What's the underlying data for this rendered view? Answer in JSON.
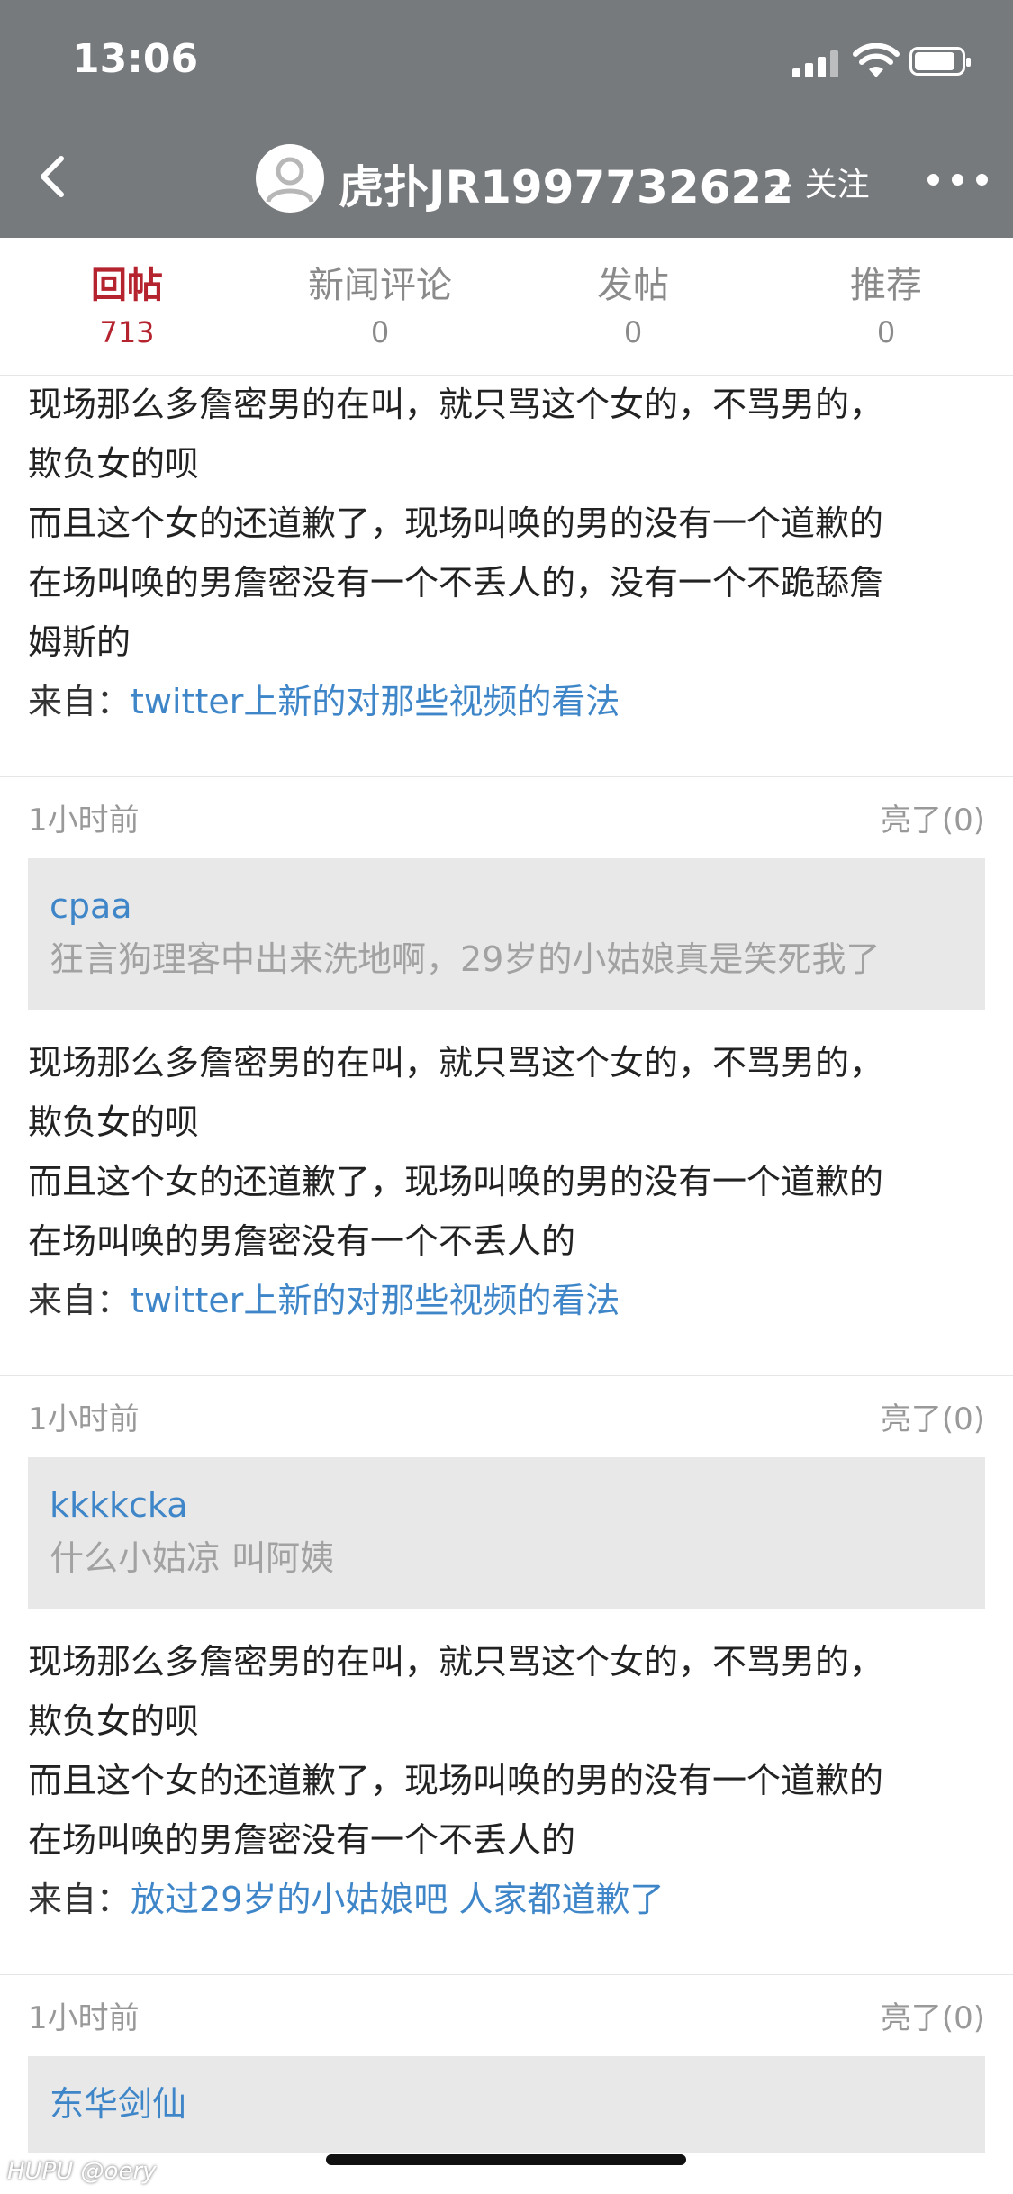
{
  "status_bar": {
    "time": "13:06"
  },
  "header": {
    "title": "虎扑JR1997732622",
    "follow_label": "+ 关注"
  },
  "tabs": [
    {
      "label": "回帖",
      "count": "713",
      "active": true
    },
    {
      "label": "新闻评论",
      "count": "0",
      "active": false
    },
    {
      "label": "发帖",
      "count": "0",
      "active": false
    },
    {
      "label": "推荐",
      "count": "0",
      "active": false
    }
  ],
  "posts": [
    {
      "lines": [
        "现场那么多詹密男的在叫，就只骂这个女的，不骂男的，",
        "欺负女的呗",
        "而且这个女的还道歉了，现场叫唤的男的没有一个道歉的",
        "在场叫唤的男詹密没有一个不丢人的，没有一个不跪舔詹",
        "姆斯的"
      ],
      "from_label": "来自：",
      "from_link": "twitter上新的对那些视频的看法"
    },
    {
      "time": "1小时前",
      "likes": "亮了(0)",
      "quote_user": "cpaa",
      "quote_text": "狂言狗理客中出来洗地啊，29岁的小姑娘真是笑死我了",
      "lines": [
        "现场那么多詹密男的在叫，就只骂这个女的，不骂男的，",
        "欺负女的呗",
        "而且这个女的还道歉了，现场叫唤的男的没有一个道歉的",
        "在场叫唤的男詹密没有一个不丢人的"
      ],
      "from_label": "来自：",
      "from_link": "twitter上新的对那些视频的看法"
    },
    {
      "time": "1小时前",
      "likes": "亮了(0)",
      "quote_user": "kkkkcka",
      "quote_text": "什么小姑凉 叫阿姨",
      "lines": [
        "现场那么多詹密男的在叫，就只骂这个女的，不骂男的，",
        "欺负女的呗",
        "而且这个女的还道歉了，现场叫唤的男的没有一个道歉的",
        "在场叫唤的男詹密没有一个不丢人的"
      ],
      "from_label": "来自：",
      "from_link": "放过29岁的小姑娘吧 人家都道歉了"
    },
    {
      "time": "1小时前",
      "likes": "亮了(0)",
      "quote_user": "东华剑仙"
    }
  ],
  "watermark": "HUPU @oery",
  "colors": {
    "header_bg": "#777a7d",
    "active_tab": "#b5232e",
    "link": "#3f86c9",
    "quote_bg": "#e8e8e8"
  }
}
